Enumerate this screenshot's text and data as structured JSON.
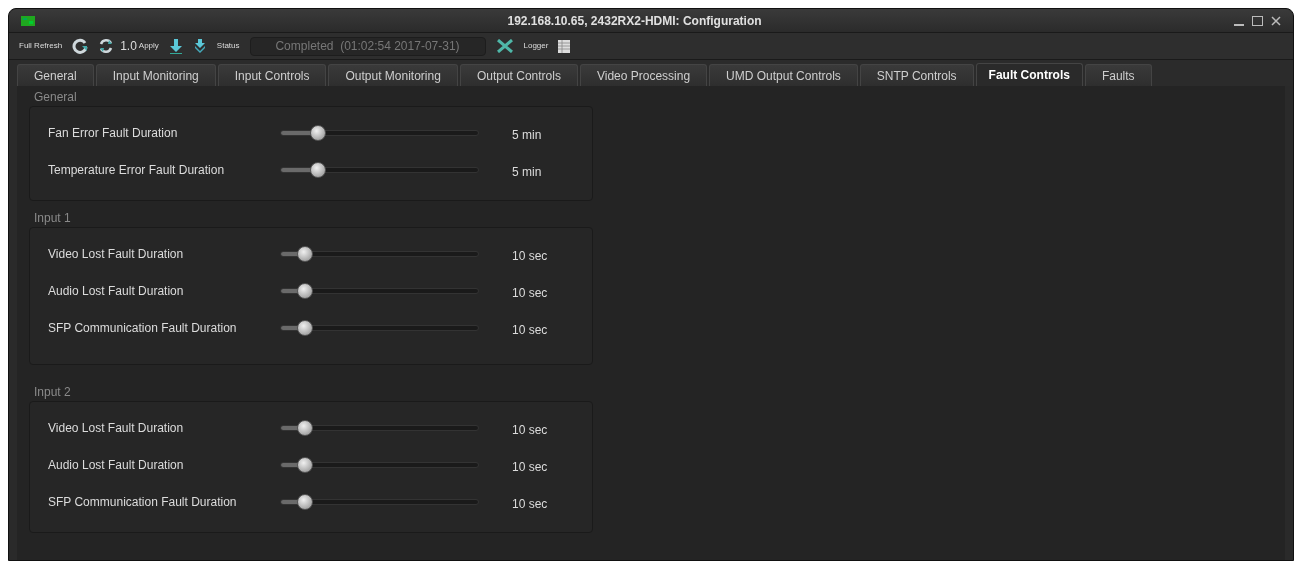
{
  "window": {
    "title": "192.168.10.65, 2432RX2-HDMI: Configuration"
  },
  "toolbar": {
    "full_refresh": "Full Refresh",
    "version": "1.0",
    "apply": "Apply",
    "status_label": "Status",
    "status": "Completed  (01:02:54 2017-07-31)",
    "logger": "Logger"
  },
  "tabs": [
    {
      "label": "General",
      "selected": false
    },
    {
      "label": "Input Monitoring",
      "selected": false
    },
    {
      "label": "Input Controls",
      "selected": false
    },
    {
      "label": "Output Monitoring",
      "selected": false
    },
    {
      "label": "Output Controls",
      "selected": false
    },
    {
      "label": "Video Processing",
      "selected": false
    },
    {
      "label": "UMD Output Controls",
      "selected": false
    },
    {
      "label": "SNTP Controls",
      "selected": false
    },
    {
      "label": "Fault Controls",
      "selected": true
    },
    {
      "label": "Faults",
      "selected": false
    }
  ],
  "sections": [
    {
      "title": "General",
      "rows": [
        {
          "label": "Fan Error Fault Duration",
          "level": 0.19,
          "reading": "5 min"
        },
        {
          "label": "Temperature Error Fault Duration",
          "level": 0.19,
          "reading": "5 min"
        }
      ]
    },
    {
      "title": "Input 1",
      "rows": [
        {
          "label": "Video Lost Fault Duration",
          "level": 0.12,
          "reading": "10 sec"
        },
        {
          "label": "Audio Lost Fault Duration",
          "level": 0.12,
          "reading": "10 sec"
        },
        {
          "label": "SFP Communication Fault Duration",
          "level": 0.12,
          "reading": "10 sec"
        }
      ]
    },
    {
      "title": "Input 2",
      "rows": [
        {
          "label": "Video Lost Fault Duration",
          "level": 0.12,
          "reading": "10 sec"
        },
        {
          "label": "Audio Lost Fault Duration",
          "level": 0.12,
          "reading": "10 sec"
        },
        {
          "label": "SFP Communication Fault Duration",
          "level": 0.12,
          "reading": "10 sec"
        }
      ]
    }
  ]
}
